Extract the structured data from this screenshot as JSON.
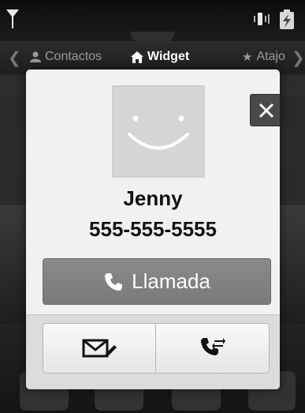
{
  "statusbar": {
    "icons": [
      "signal-icon",
      "vibrate-icon",
      "battery-charging-icon"
    ]
  },
  "tabs": {
    "items": [
      {
        "label": "Contactos",
        "icon": "person-icon",
        "active": false
      },
      {
        "label": "Widget",
        "icon": "home-icon",
        "active": true
      },
      {
        "label": "Atajo",
        "icon": "star-icon",
        "active": false
      }
    ]
  },
  "dialog": {
    "name": "Jenny",
    "number": "555-555-5555",
    "call_label": "Llamada",
    "icons": {
      "close": "close-icon",
      "avatar": "smiley-avatar-icon",
      "call": "phone-icon",
      "message": "message-icon",
      "call_forward": "call-transfer-icon"
    }
  },
  "colors": {
    "dialog_bg": "#f1f1f1",
    "call_button": "#808080",
    "close_button": "#4a4a4a"
  }
}
